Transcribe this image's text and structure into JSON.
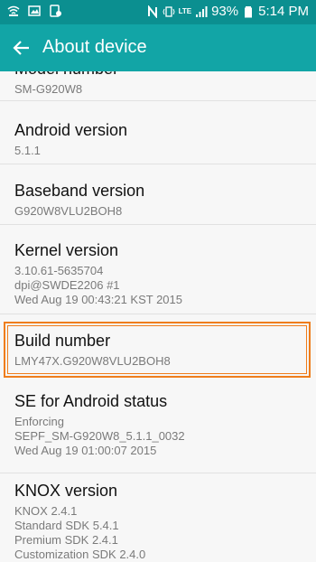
{
  "status_bar": {
    "battery_percent": "93%",
    "time": "5:14 PM",
    "network": "LTE",
    "left_icons": [
      "wifi-icon",
      "image-icon",
      "tablet-icon"
    ],
    "right_icons": [
      "nfc-icon",
      "vibrate-icon",
      "signal-icon",
      "battery-icon"
    ]
  },
  "app_bar": {
    "title": "About device",
    "back_icon": "arrow-left-icon"
  },
  "colors": {
    "status_bar": "#0b8f90",
    "app_bar": "#12a5a6",
    "highlight": "#ef7d1c"
  },
  "items": [
    {
      "title": "Model number",
      "sub": [
        "SM-G920W8"
      ]
    },
    {
      "title": "Android version",
      "sub": [
        "5.1.1"
      ]
    },
    {
      "title": "Baseband version",
      "sub": [
        "G920W8VLU2BOH8"
      ]
    },
    {
      "title": "Kernel version",
      "sub": [
        "3.10.61-5635704",
        "dpi@SWDE2206 #1",
        "Wed Aug 19 00:43:21 KST 2015"
      ]
    },
    {
      "title": "Build number",
      "sub": [
        "LMY47X.G920W8VLU2BOH8"
      ]
    },
    {
      "title": "SE for Android status",
      "sub": [
        "Enforcing",
        "SEPF_SM-G920W8_5.1.1_0032",
        "Wed Aug 19 01:00:07 2015"
      ]
    },
    {
      "title": "KNOX version",
      "sub": [
        "KNOX 2.4.1",
        "Standard SDK 5.4.1",
        "Premium SDK 2.4.1",
        "Customization SDK 2.4.0"
      ]
    }
  ]
}
